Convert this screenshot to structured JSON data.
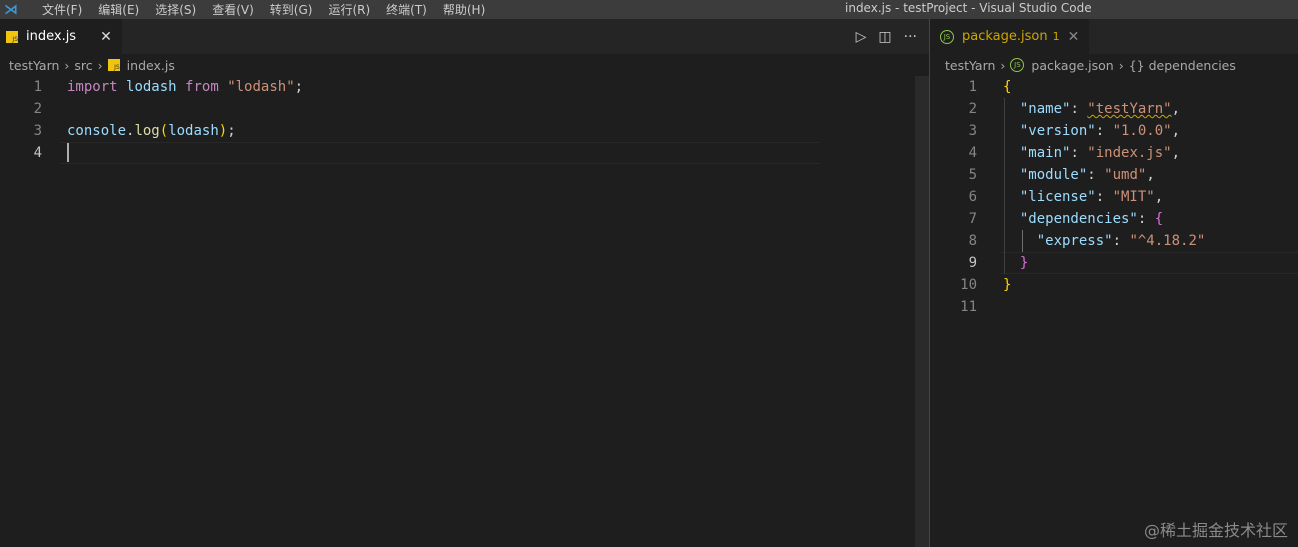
{
  "window_title": "index.js - testProject - Visual Studio Code",
  "menu": [
    "文件(F)",
    "编辑(E)",
    "选择(S)",
    "查看(V)",
    "转到(G)",
    "运行(R)",
    "终端(T)",
    "帮助(H)"
  ],
  "left": {
    "tab": {
      "label": "index.js",
      "icon": "js-file-icon"
    },
    "breadcrumb": [
      "testYarn",
      "src",
      "index.js"
    ],
    "lines": [
      {
        "n": "1",
        "tokens": [
          [
            "kw",
            "import"
          ],
          [
            "p",
            " "
          ],
          [
            "var",
            "lodash"
          ],
          [
            "p",
            " "
          ],
          [
            "kw",
            "from"
          ],
          [
            "p",
            " "
          ],
          [
            "str",
            "\"lodash\""
          ],
          [
            "p",
            ";"
          ]
        ]
      },
      {
        "n": "2",
        "tokens": []
      },
      {
        "n": "3",
        "tokens": [
          [
            "var",
            "console"
          ],
          [
            "p",
            "."
          ],
          [
            "fn",
            "log"
          ],
          [
            "b1",
            "("
          ],
          [
            "var",
            "lodash"
          ],
          [
            "b1",
            ")"
          ],
          [
            "p",
            ";"
          ]
        ]
      },
      {
        "n": "4",
        "tokens": []
      }
    ]
  },
  "right": {
    "tab": {
      "label": "package.json",
      "badge": "1",
      "icon": "nodejs-icon"
    },
    "breadcrumb": [
      "testYarn",
      "package.json",
      "{} dependencies"
    ],
    "lines": [
      {
        "n": "1",
        "tokens": [
          [
            "b1",
            "{"
          ]
        ]
      },
      {
        "n": "2",
        "tokens": [
          [
            "p",
            "  "
          ],
          [
            "key",
            "\"name\""
          ],
          [
            "p",
            ": "
          ],
          [
            "str squig",
            "\"testYarn\""
          ],
          [
            "p",
            ","
          ]
        ]
      },
      {
        "n": "3",
        "tokens": [
          [
            "p",
            "  "
          ],
          [
            "key",
            "\"version\""
          ],
          [
            "p",
            ": "
          ],
          [
            "str",
            "\"1.0.0\""
          ],
          [
            "p",
            ","
          ]
        ]
      },
      {
        "n": "4",
        "tokens": [
          [
            "p",
            "  "
          ],
          [
            "key",
            "\"main\""
          ],
          [
            "p",
            ": "
          ],
          [
            "str",
            "\"index.js\""
          ],
          [
            "p",
            ","
          ]
        ]
      },
      {
        "n": "5",
        "tokens": [
          [
            "p",
            "  "
          ],
          [
            "key",
            "\"module\""
          ],
          [
            "p",
            ": "
          ],
          [
            "str",
            "\"umd\""
          ],
          [
            "p",
            ","
          ]
        ]
      },
      {
        "n": "6",
        "tokens": [
          [
            "p",
            "  "
          ],
          [
            "key",
            "\"license\""
          ],
          [
            "p",
            ": "
          ],
          [
            "str",
            "\"MIT\""
          ],
          [
            "p",
            ","
          ]
        ]
      },
      {
        "n": "7",
        "tokens": [
          [
            "p",
            "  "
          ],
          [
            "key",
            "\"dependencies\""
          ],
          [
            "p",
            ": "
          ],
          [
            "b2",
            "{"
          ]
        ]
      },
      {
        "n": "8",
        "tokens": [
          [
            "p",
            "    "
          ],
          [
            "key",
            "\"express\""
          ],
          [
            "p",
            ": "
          ],
          [
            "str",
            "\"^4.18.2\""
          ]
        ]
      },
      {
        "n": "9",
        "tokens": [
          [
            "p",
            "  "
          ],
          [
            "b2",
            "}"
          ]
        ]
      },
      {
        "n": "10",
        "tokens": [
          [
            "b1",
            "}"
          ]
        ]
      },
      {
        "n": "11",
        "tokens": []
      }
    ]
  },
  "watermark": "@稀土掘金技术社区"
}
